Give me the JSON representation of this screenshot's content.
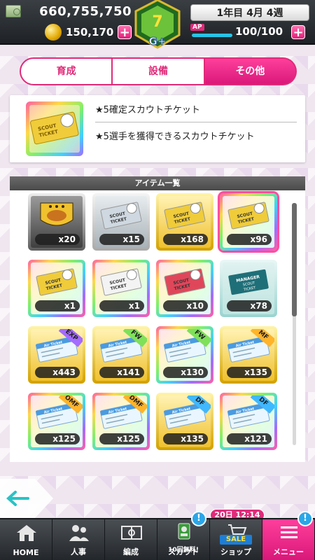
{
  "header": {
    "money": "660,755,750",
    "coins": "150,170",
    "week": "1年目 4月 4週",
    "ap_label": "AP",
    "ap_value": "100/100",
    "rank": "G+",
    "plus": "+"
  },
  "tabs": [
    {
      "label": "育成",
      "active": false
    },
    {
      "label": "設備",
      "active": false
    },
    {
      "label": "その他",
      "active": true
    }
  ],
  "detail": {
    "name": "★5確定スカウトチケット",
    "description": "★5選手を獲得できるスカウトチケット",
    "ticket_text": "SCOUT TICKET"
  },
  "list": {
    "header": "アイテム一覧",
    "items": [
      {
        "qty": "x20",
        "frame": "gray",
        "kind": "badge",
        "tag": ""
      },
      {
        "qty": "x15",
        "frame": "silver",
        "kind": "scout",
        "tag": ""
      },
      {
        "qty": "x168",
        "frame": "gold",
        "kind": "scout",
        "tag": ""
      },
      {
        "qty": "x96",
        "frame": "rainbow",
        "kind": "scout",
        "tag": "",
        "selected": true
      },
      {
        "qty": "x1",
        "frame": "rainbow",
        "kind": "scout",
        "tag": ""
      },
      {
        "qty": "x1",
        "frame": "rainbow",
        "kind": "scout",
        "tag": ""
      },
      {
        "qty": "x10",
        "frame": "rainbow",
        "kind": "scout",
        "tag": ""
      },
      {
        "qty": "x78",
        "frame": "teal",
        "kind": "manager",
        "tag": ""
      },
      {
        "qty": "x443",
        "frame": "gold",
        "kind": "air",
        "tag": "EXP"
      },
      {
        "qty": "x141",
        "frame": "gold",
        "kind": "air",
        "tag": "FW"
      },
      {
        "qty": "x130",
        "frame": "rainbow",
        "kind": "air",
        "tag": "FW"
      },
      {
        "qty": "x135",
        "frame": "gold",
        "kind": "air",
        "tag": "MF"
      },
      {
        "qty": "x125",
        "frame": "rainbow",
        "kind": "air",
        "tag": "OMF"
      },
      {
        "qty": "x125",
        "frame": "rainbow",
        "kind": "air",
        "tag": "DMF"
      },
      {
        "qty": "x135",
        "frame": "gold",
        "kind": "air",
        "tag": "DF"
      },
      {
        "qty": "x121",
        "frame": "rainbow",
        "kind": "air",
        "tag": "DF"
      }
    ],
    "scout_text": "SCOUT TICKET",
    "manager_text": "MANAGER SCOUT TICKET",
    "air_text": "Air Ticket"
  },
  "nav": {
    "items": [
      {
        "label": "HOME",
        "icon": "home-icon"
      },
      {
        "label": "人事",
        "icon": "people-icon"
      },
      {
        "label": "編成",
        "icon": "field-icon"
      },
      {
        "label": "スカウト",
        "icon": "scout-icon",
        "sub": "10回無料!",
        "badge": "!"
      },
      {
        "label": "ショップ",
        "icon": "shop-icon",
        "sale": "SALE",
        "timer": "20日 12:14"
      },
      {
        "label": "メニュー",
        "icon": "menu-icon",
        "badge": "!"
      }
    ]
  },
  "colors": {
    "accent": "#e02a79",
    "nav_dark": "#23272b",
    "ap_bar": "#28c3e6"
  }
}
